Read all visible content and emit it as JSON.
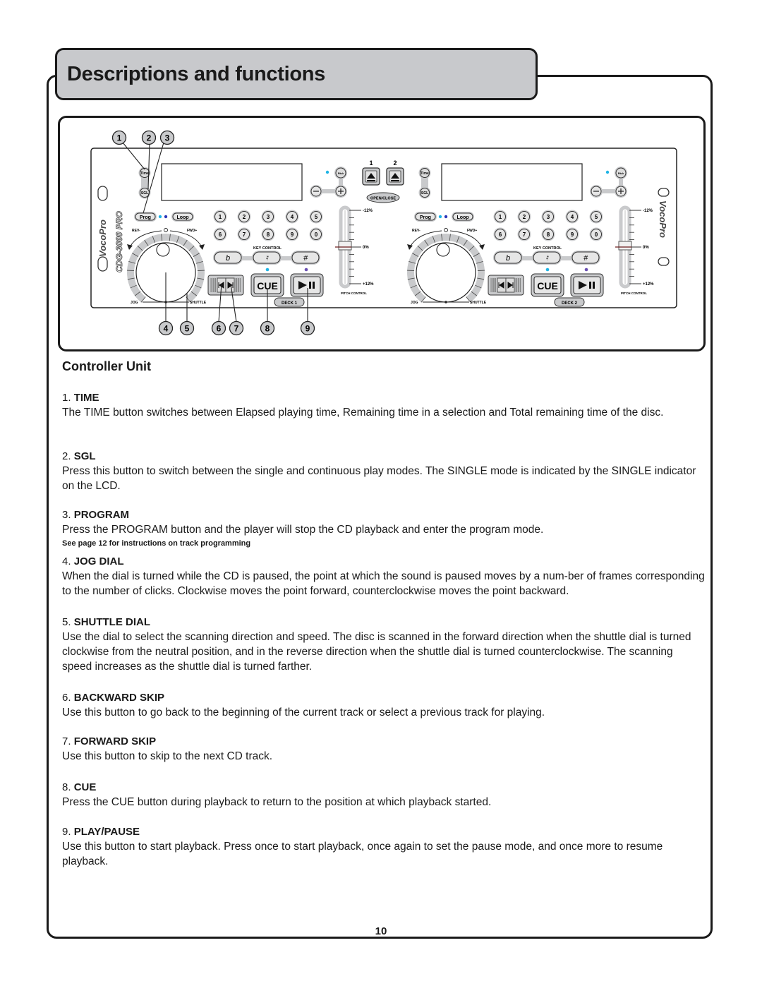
{
  "page": {
    "title": "Descriptions and functions",
    "section_title": "Controller Unit",
    "page_number": "10"
  },
  "diagram": {
    "callouts_top": [
      "1",
      "2",
      "3"
    ],
    "callouts_bottom": [
      "4",
      "5",
      "6",
      "7",
      "8",
      "9"
    ],
    "brand": "VocoPro",
    "model": "CDG-3000 PRO",
    "eject_labels": [
      "1",
      "2"
    ],
    "open_close_label": "OPEN/CLOSE",
    "decks": [
      {
        "name": "DECK 1",
        "time_label": "Time",
        "sgl_label": "SGL",
        "prog_label": "Prog",
        "loop_label": "Loop",
        "pitch_label": "Pitch",
        "rev_label": "REV-",
        "fwd_label": "FWD+",
        "jog_label": "JOG",
        "shuttle_label": "SHUTTLE",
        "number_keys": [
          "1",
          "2",
          "3",
          "4",
          "5",
          "6",
          "7",
          "8",
          "9",
          "0"
        ],
        "key_control_label": "KEY CONTROL",
        "key_buttons": [
          "b",
          "♮",
          "#"
        ],
        "cue_label": "CUE",
        "pitch_control_label": "PITCH CONTROL",
        "pitch_scale": [
          "-12%",
          "0%",
          "+12%"
        ]
      },
      {
        "name": "DECK 2",
        "time_label": "Time",
        "sgl_label": "SGL",
        "prog_label": "Prog",
        "loop_label": "Loop",
        "pitch_label": "Pitch",
        "rev_label": "REV-",
        "fwd_label": "FWD+",
        "jog_label": "JOG",
        "shuttle_label": "SHUTTLE",
        "number_keys": [
          "1",
          "2",
          "3",
          "4",
          "5",
          "6",
          "7",
          "8",
          "9",
          "0"
        ],
        "key_control_label": "KEY CONTROL",
        "key_buttons": [
          "b",
          "♮",
          "#"
        ],
        "cue_label": "CUE",
        "pitch_control_label": "PITCH CONTROL",
        "pitch_scale": [
          "-12%",
          "0%",
          "+12%"
        ]
      }
    ],
    "icons": {
      "eject": "eject-icon",
      "skip_back": "skip-back-icon",
      "skip_forward": "skip-forward-icon",
      "play_pause": "play-pause-icon"
    },
    "colors": {
      "led_cyan": "#1fb4e6",
      "led_blue": "#2b35b8",
      "panel_gray": "#c9cacc",
      "title_tab_gray": "#c8c9cc"
    }
  },
  "items": [
    {
      "num": "1.",
      "title": "TIME",
      "body": "The TIME button switches between Elapsed playing time, Remaining time in a selection and Total remaining time of the disc."
    },
    {
      "num": "2.",
      "title": "SGL",
      "body": "Press this button to switch between the single and continuous play modes. The SINGLE mode is indicated by the SINGLE indicator on the LCD."
    },
    {
      "num": "3.",
      "title": "PROGRAM",
      "body": "Press the PROGRAM button and the player will stop the CD playback and enter the program mode.",
      "note": "See page 12 for instructions on track programming"
    },
    {
      "num": "4.",
      "title": "JOG DIAL",
      "body": "When the dial is turned while the CD is paused, the point at which the sound is paused moves by a num-ber of frames corresponding to the number of clicks. Clockwise moves the point forward, counterclockwise moves the point backward."
    },
    {
      "num": "5.",
      "title": "SHUTTLE DIAL",
      "body": "Use the dial to select the scanning direction and speed. The disc is scanned in the forward direction when the shuttle dial is turned clockwise from the neutral position,  and in the reverse direction when the shuttle dial is turned counterclockwise. The scanning speed increases as the shuttle dial is turned farther."
    },
    {
      "num": "6.",
      "title": "BACKWARD SKIP",
      "body": "Use this button to go back to the beginning of the current track or select a previous track for playing."
    },
    {
      "num": "7.",
      "title": "FORWARD SKIP",
      "body": "Use this button to skip to the next CD track."
    },
    {
      "num": "8.",
      "title": "CUE",
      "body": "Press the CUE button during playback to return to the position at which playback started."
    },
    {
      "num": "9.",
      "title": "PLAY/PAUSE",
      "body": "Use this button to start playback. Press once to start playback, once again to set the pause mode, and once more to resume playback."
    }
  ]
}
